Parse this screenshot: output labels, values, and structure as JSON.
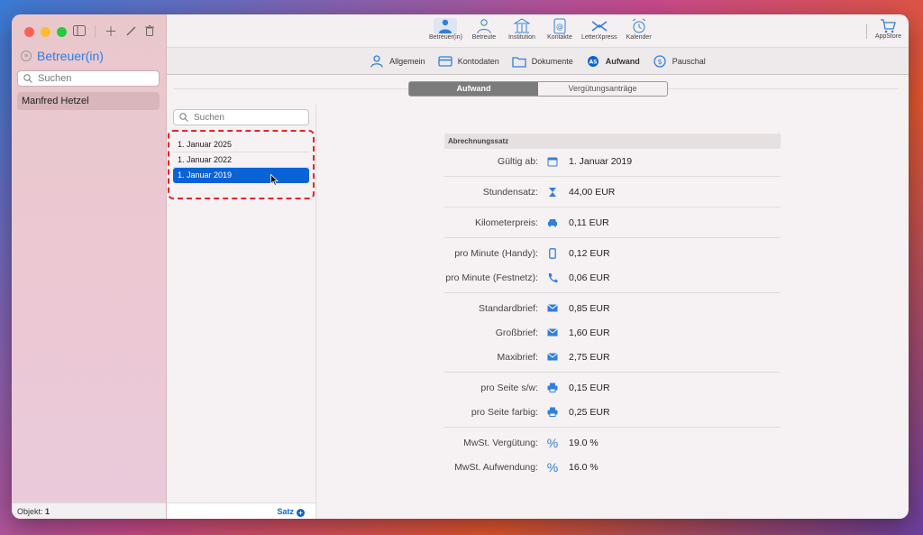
{
  "sidebar": {
    "title": "Betreuer(in)",
    "search_placeholder": "Suchen",
    "items": [
      {
        "label": "Manfred Hetzel"
      }
    ],
    "footer_label": "Objekt:",
    "footer_count": "1"
  },
  "toolbar": {
    "items": [
      {
        "label": "Betreuer(in)",
        "icon": "person-icon",
        "active": true
      },
      {
        "label": "Betreute",
        "icon": "person-outline-icon"
      },
      {
        "label": "Institution",
        "icon": "institution-icon"
      },
      {
        "label": "Kontakte",
        "icon": "contacts-icon"
      },
      {
        "label": "LetterXpress",
        "icon": "letterxpress-icon"
      },
      {
        "label": "Kalender",
        "icon": "alarm-clock-icon"
      }
    ],
    "appstore_label": "AppStore"
  },
  "subbar": {
    "items": [
      {
        "label": "Allgemein",
        "icon": "person-icon"
      },
      {
        "label": "Kontodaten",
        "icon": "card-icon"
      },
      {
        "label": "Dokumente",
        "icon": "folder-icon"
      },
      {
        "label": "Aufwand",
        "icon": "as-badge-icon",
        "active": true
      },
      {
        "label": "Pauschal",
        "icon": "dollar-circle-icon"
      }
    ]
  },
  "segmented": {
    "tabs": [
      "Aufwand",
      "Vergütungsanträge"
    ],
    "active": 0
  },
  "list": {
    "search_placeholder": "Suchen",
    "dates": [
      "1. Januar 2025",
      "1. Januar 2022",
      "1. Januar 2019"
    ],
    "selected": 2,
    "footer_label": "Satz"
  },
  "form": {
    "header": "Abrechnungssatz",
    "rows": [
      {
        "label": "Gültig ab:",
        "value": "1. Januar 2019",
        "icon": "calendar-icon"
      },
      {
        "label": "Stundensatz:",
        "value": "44,00 EUR",
        "icon": "hourglass-icon"
      },
      {
        "label": "Kilometerpreis:",
        "value": "0,11 EUR",
        "icon": "car-icon"
      },
      {
        "label": "pro Minute (Handy):",
        "value": "0,12 EUR",
        "icon": "mobile-phone-icon"
      },
      {
        "label": "pro Minute (Festnetz):",
        "value": "0,06 EUR",
        "icon": "phone-icon"
      },
      {
        "label": "Standardbrief:",
        "value": "0,85 EUR",
        "icon": "envelope-icon"
      },
      {
        "label": "Großbrief:",
        "value": "1,60 EUR",
        "icon": "envelope-icon"
      },
      {
        "label": "Maxibrief:",
        "value": "2,75 EUR",
        "icon": "envelope-icon"
      },
      {
        "label": "pro Seite s/w:",
        "value": "0,15 EUR",
        "icon": "printer-icon"
      },
      {
        "label": "pro Seite farbig:",
        "value": "0,25 EUR",
        "icon": "printer-icon"
      },
      {
        "label": "MwSt. Vergütung:",
        "value": "19.0 %",
        "icon": "percent-icon"
      },
      {
        "label": "MwSt. Aufwendung:",
        "value": "16.0 %",
        "icon": "percent-icon"
      }
    ]
  },
  "colors": {
    "accent": "#0a63d6",
    "highlight_border": "#e0262b"
  }
}
